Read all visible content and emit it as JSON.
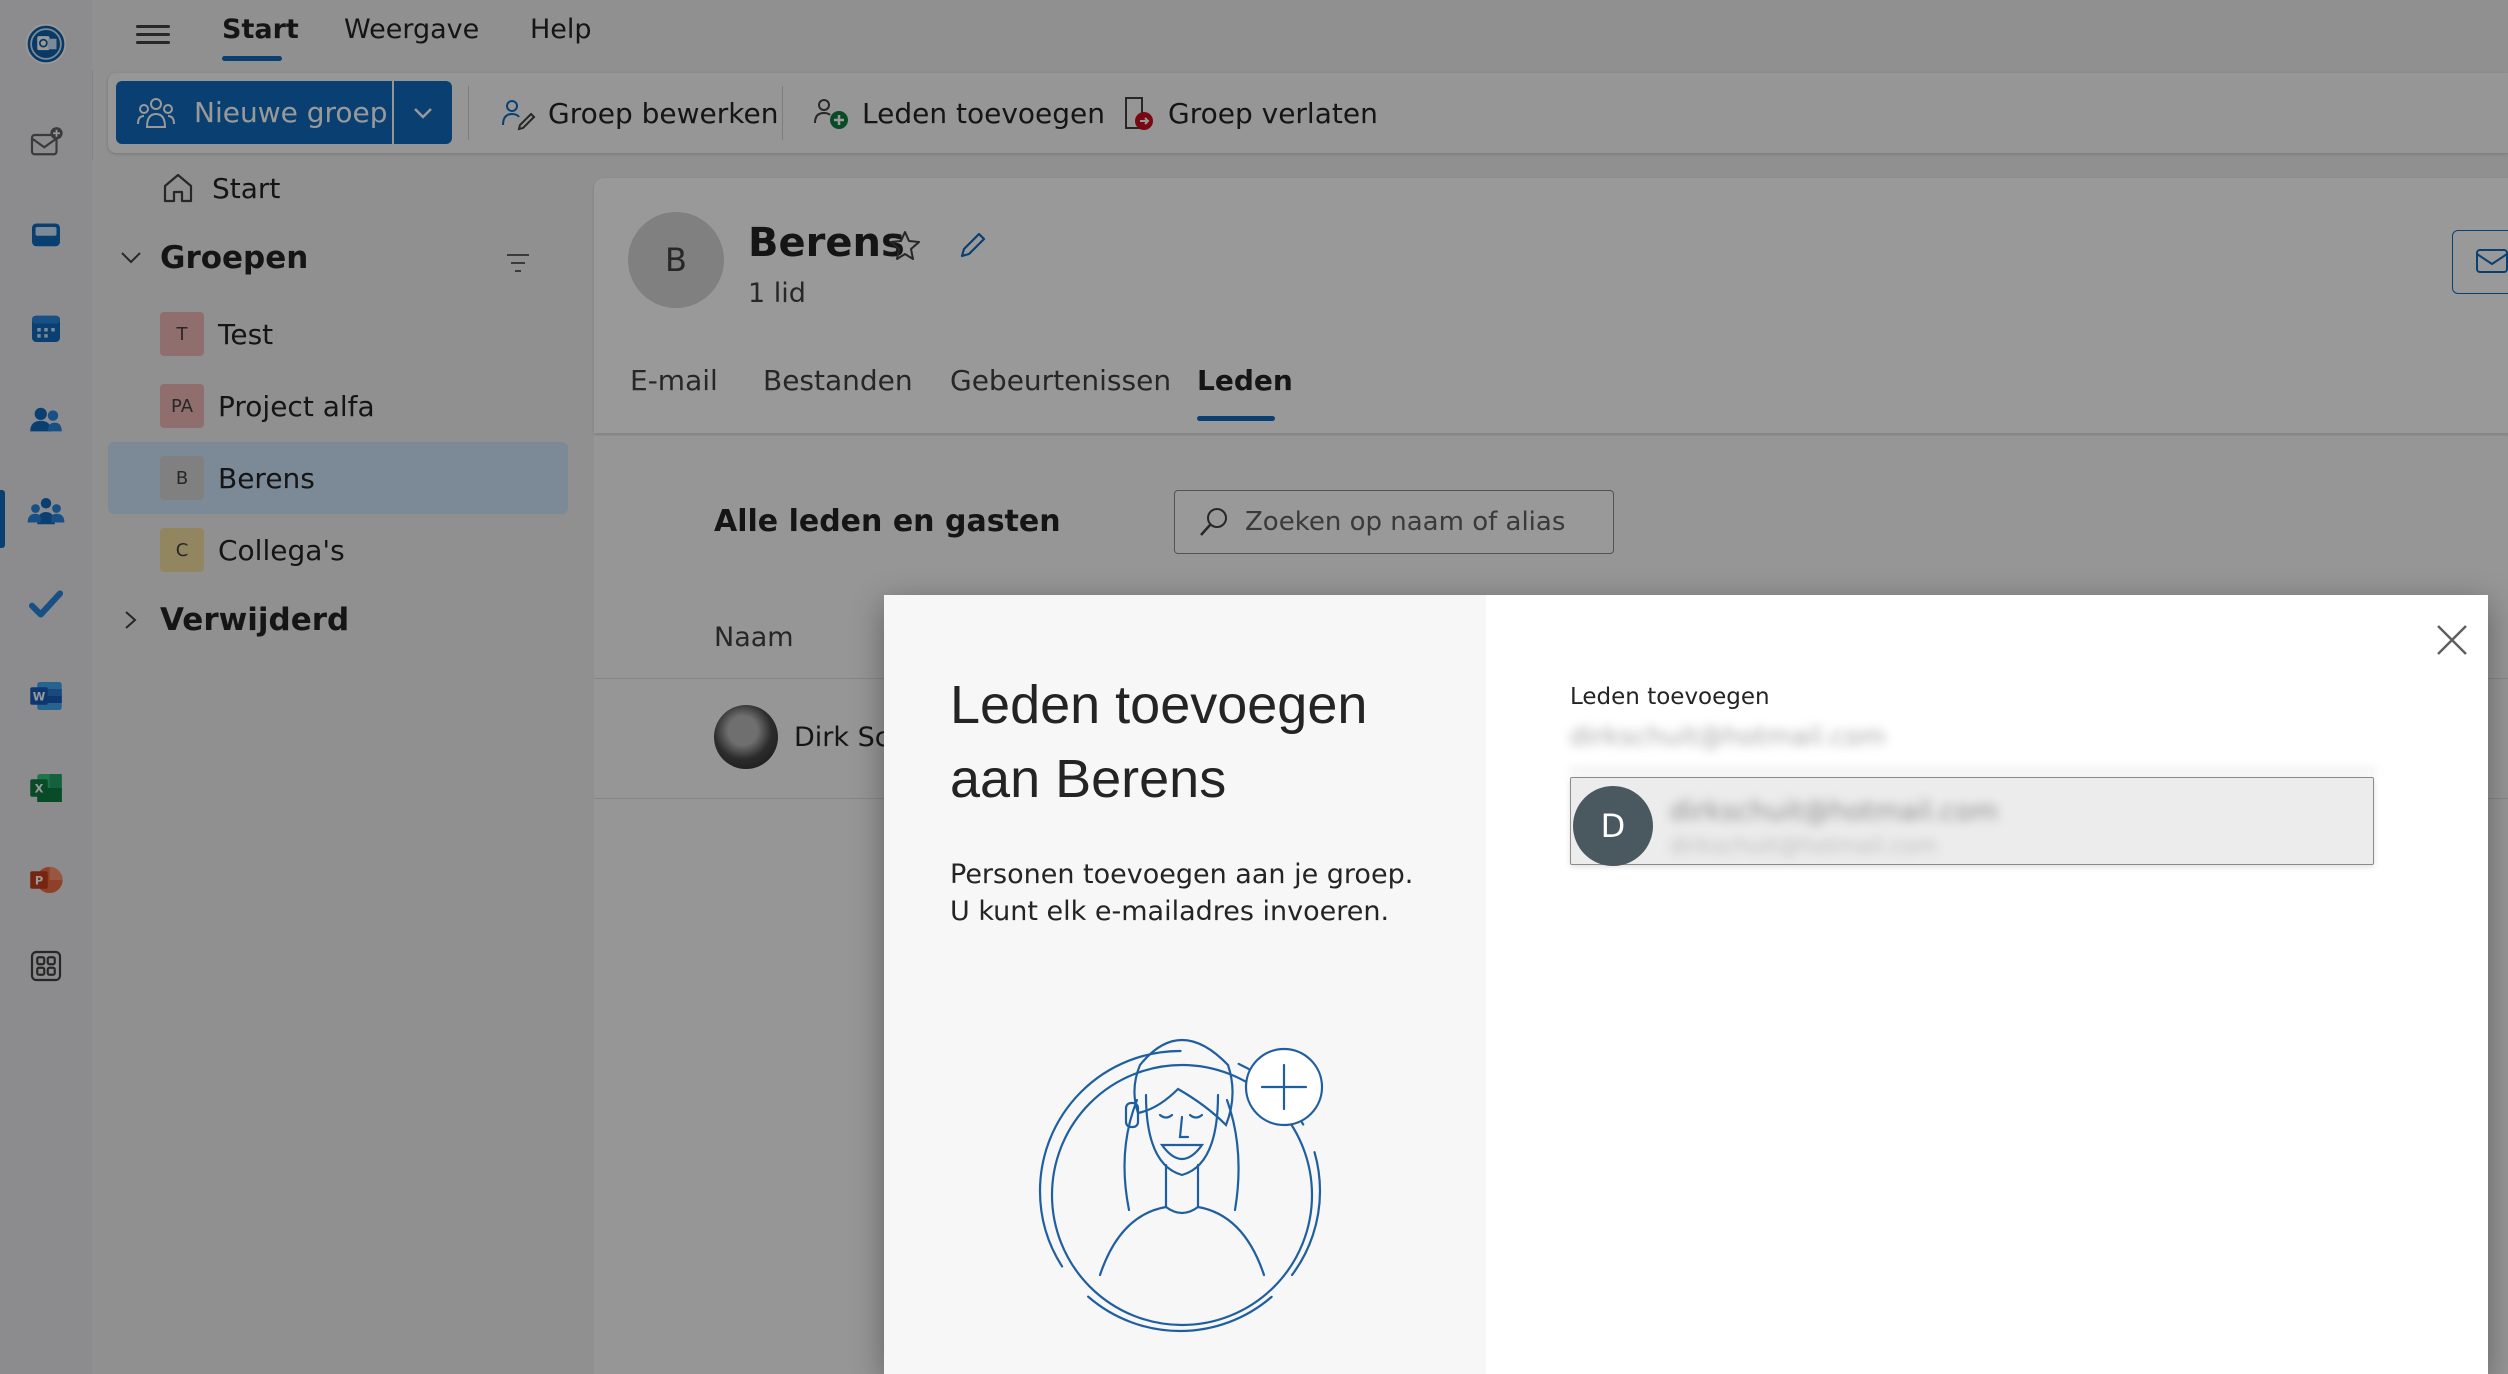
{
  "app": {
    "name": "Outlook"
  },
  "menu": {
    "tabs": [
      "Start",
      "Weergave",
      "Help"
    ],
    "active": "Start"
  },
  "ribbon": {
    "new_group": "Nieuwe groep",
    "edit_group": "Groep bewerken",
    "add_members": "Leden toevoegen",
    "leave_group": "Groep verlaten"
  },
  "nav": {
    "home": "Start",
    "groups_header": "Groepen",
    "groups": [
      {
        "initials": "T",
        "name": "Test",
        "color": "#f0b8b8"
      },
      {
        "initials": "PA",
        "name": "Project alfa",
        "color": "#f0b8b8"
      },
      {
        "initials": "B",
        "name": "Berens",
        "color": "#d6d6d6"
      },
      {
        "initials": "C",
        "name": "Collega's",
        "color": "#f3dfa2"
      }
    ],
    "deleted": "Verwijderd"
  },
  "group": {
    "initial": "B",
    "name": "Berens",
    "member_count": "1 lid",
    "tabs": [
      "E-mail",
      "Bestanden",
      "Gebeurtenissen",
      "Leden"
    ],
    "active_tab": "Leden"
  },
  "members": {
    "heading": "Alle leden en gasten",
    "search_placeholder": "Zoeken op naam of alias",
    "column_name": "Naam",
    "rows": [
      {
        "name": "Dirk Sch"
      }
    ]
  },
  "dialog": {
    "title_line1": "Leden toevoegen",
    "title_line2": "aan Berens",
    "description": "Personen toevoegen aan je groep. U kunt elk e-mailadres invoeren.",
    "field_label": "Leden toevoegen",
    "field_value": "dirkschuit@hotmail.com",
    "suggestion": {
      "initial": "D",
      "line1": "dirkschuit@hotmail.com",
      "line2": "dirkschuit@hotmail.com"
    }
  },
  "colors": {
    "accent": "#0f6cbd",
    "selected": "#cfe4fa"
  }
}
